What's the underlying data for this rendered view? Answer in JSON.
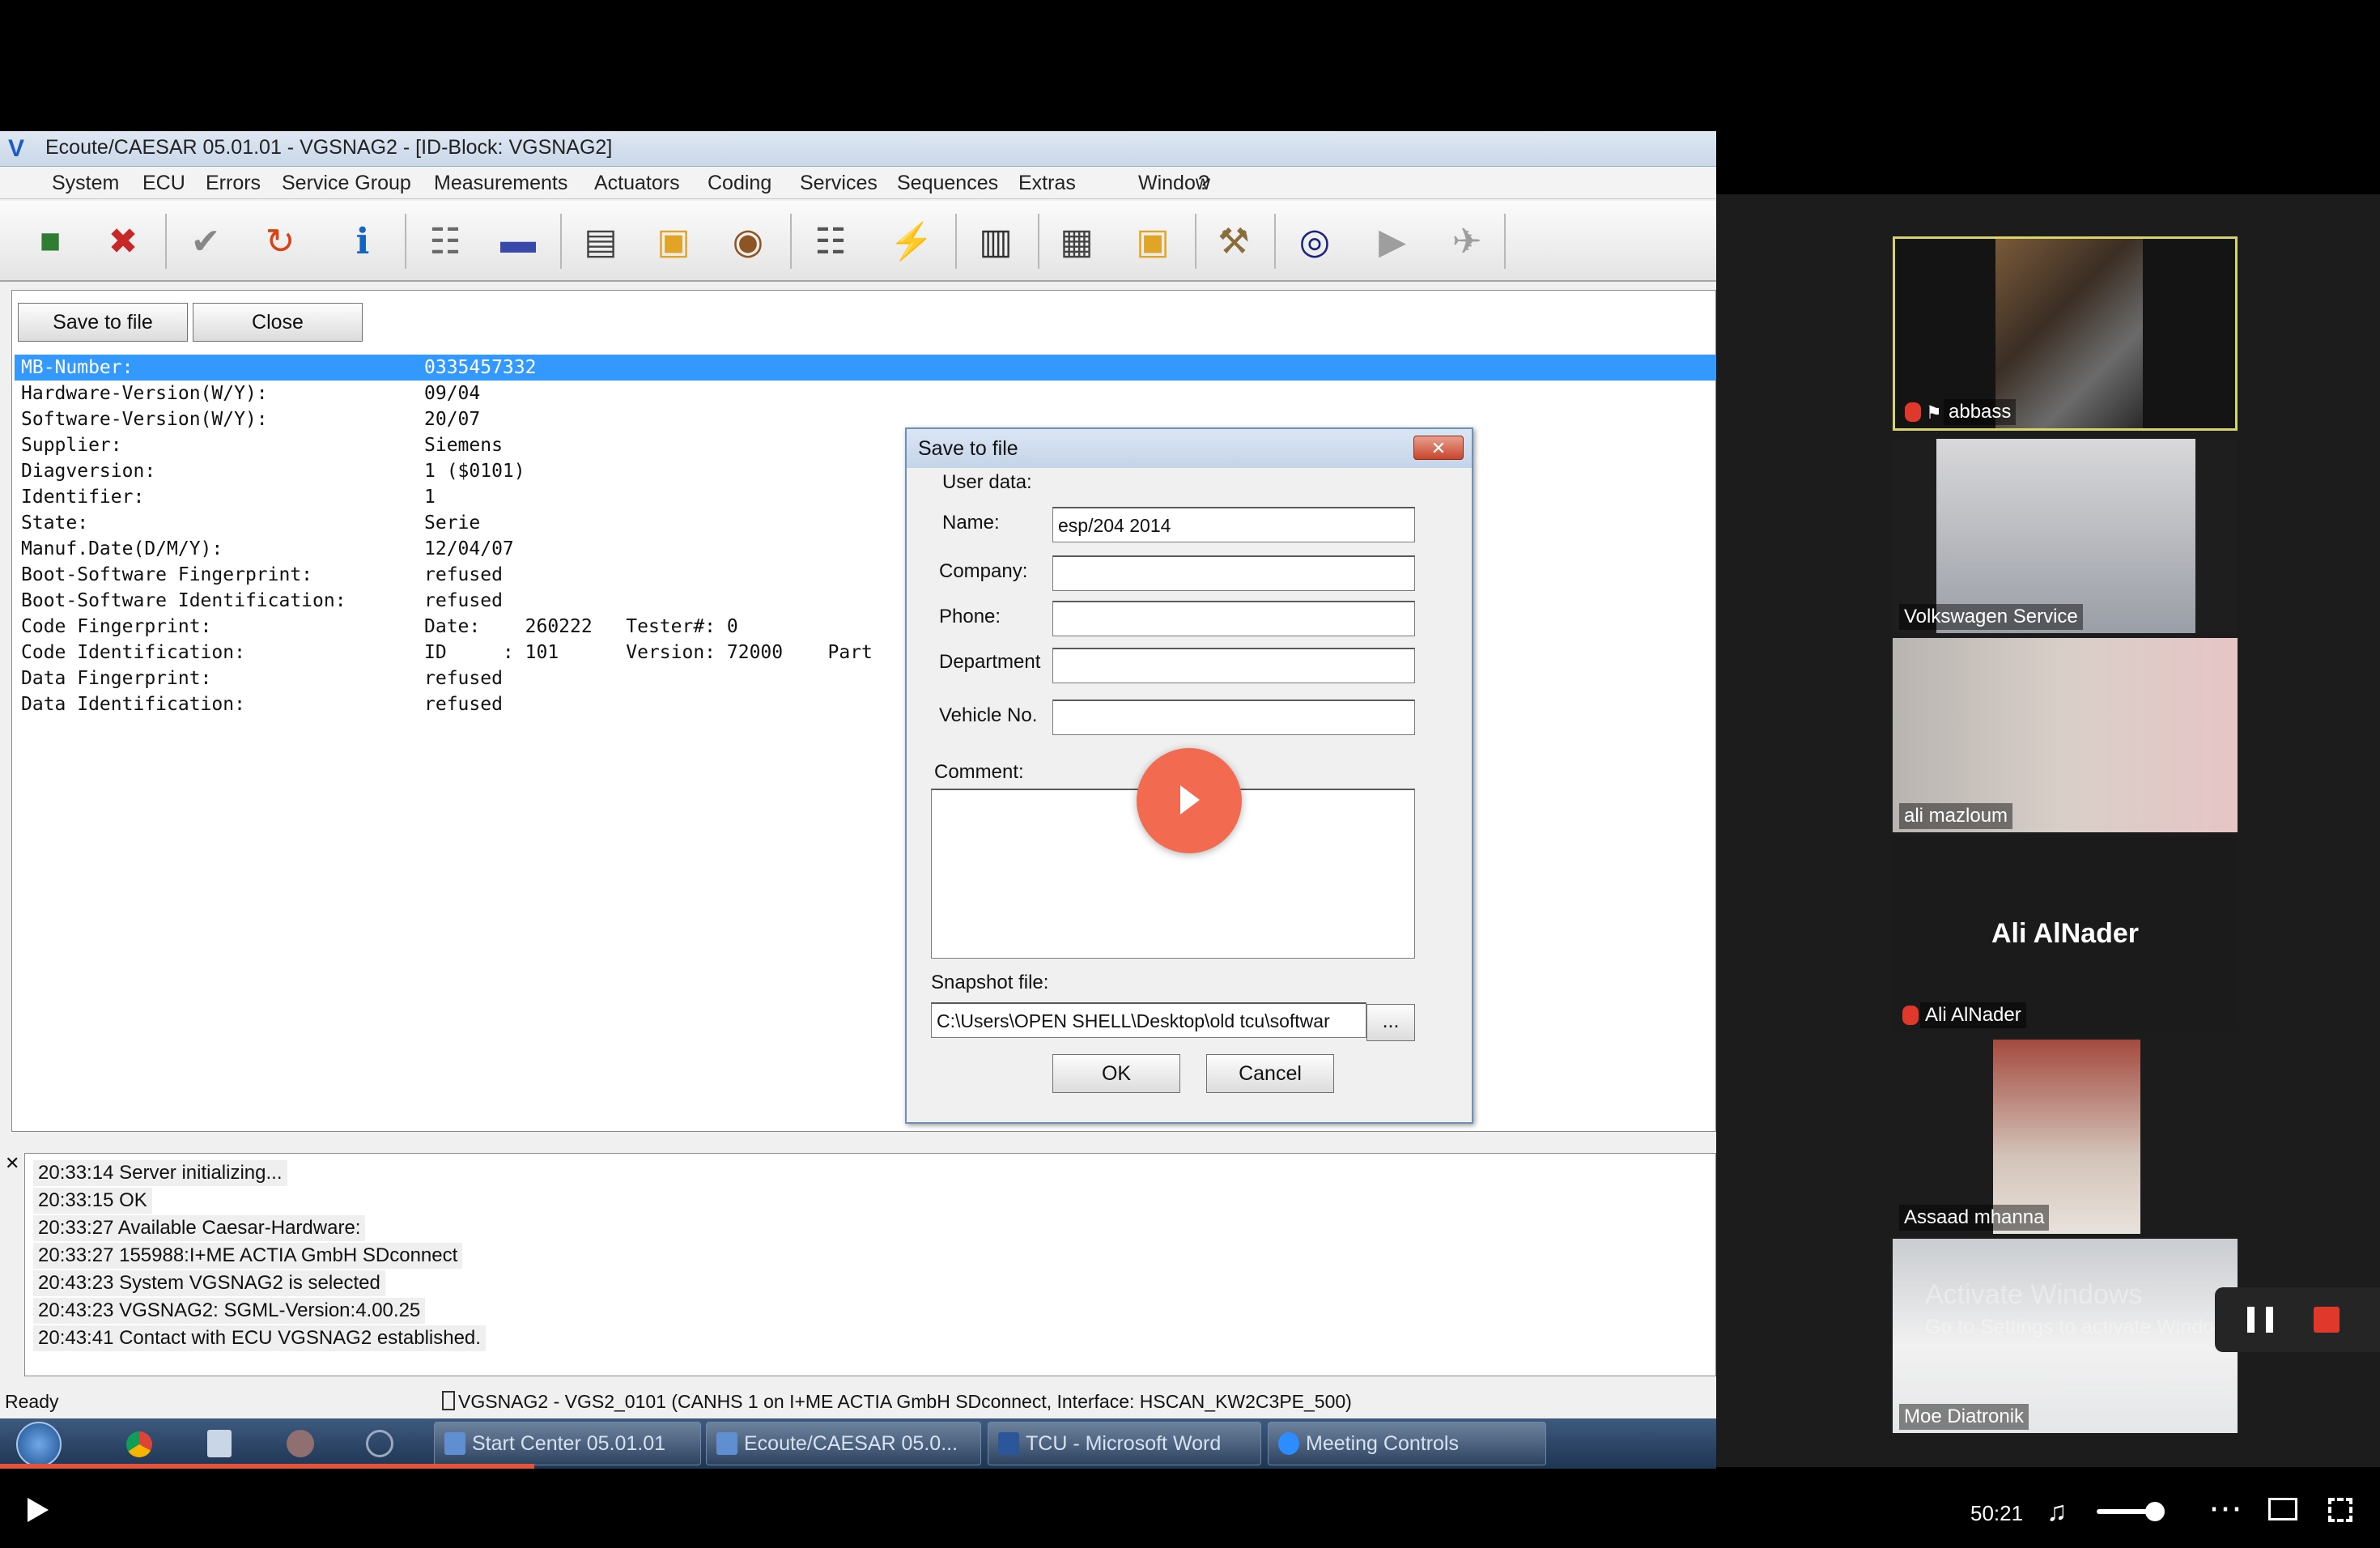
{
  "window": {
    "title": "Ecoute/CAESAR 05.01.01 - VGSNAG2 - [ID-Block: VGSNAG2]"
  },
  "menu": [
    "System",
    "ECU",
    "Errors",
    "Service Group",
    "Measurements",
    "Actuators",
    "Coding",
    "Services",
    "Sequences",
    "Extras",
    "Window",
    "?"
  ],
  "toolbar_icons": [
    "ecu-connect-icon",
    "ecu-disconnect-icon",
    "check-icon",
    "reset-icon",
    "hardware-info-icon",
    "fault-memory-icon",
    "vehicle-icon",
    "measure-window-icon",
    "open-folder-icon",
    "eye-icon",
    "network-tree-icon",
    "flash-icon",
    "document-icon",
    "table-list-icon",
    "save-folder-icon",
    "tools-icon",
    "binoculars-icon",
    "connector-icon",
    "plug-icon"
  ],
  "buttons": {
    "save_to_file": "Save to file",
    "close": "Close"
  },
  "id_block": [
    {
      "key": "MB-Number:",
      "value": "0335457332"
    },
    {
      "key": "Hardware-Version(W/Y):",
      "value": "09/04"
    },
    {
      "key": "Software-Version(W/Y):",
      "value": "20/07"
    },
    {
      "key": "Supplier:",
      "value": "Siemens"
    },
    {
      "key": "Diagversion:",
      "value": "1 ($0101)"
    },
    {
      "key": "Identifier:",
      "value": "1"
    },
    {
      "key": "State:",
      "value": "Serie"
    },
    {
      "key": "Manuf.Date(D/M/Y):",
      "value": "12/04/07"
    },
    {
      "key": "Boot-Software Fingerprint:",
      "value": "refused"
    },
    {
      "key": "Boot-Software Identification:",
      "value": "refused"
    },
    {
      "key": "Code Fingerprint:",
      "value": "Date:    260222   Tester#: 0"
    },
    {
      "key": "Code Identification:",
      "value": "ID     : 101      Version: 72000    Part"
    },
    {
      "key": "Data Fingerprint:",
      "value": "refused"
    },
    {
      "key": "Data Identification:",
      "value": "refused"
    }
  ],
  "dialog": {
    "title": "Save to file",
    "user_data": "User data:",
    "name_label": "Name:",
    "name_value": "esp/204 2014",
    "company_label": "Company:",
    "company_value": "",
    "phone_label": "Phone:",
    "phone_value": "",
    "department_label": "Department",
    "department_value": "",
    "vehicle_label": "Vehicle No.",
    "vehicle_value": "",
    "comment_label": "Comment:",
    "comment_value": "",
    "snapshot_label": "Snapshot file:",
    "snapshot_value": "C:\\Users\\OPEN SHELL\\Desktop\\old tcu\\softwar",
    "browse": "...",
    "ok": "OK",
    "cancel": "Cancel"
  },
  "log": [
    "20:33:14 Server initializing...",
    "20:33:15 OK",
    "20:33:27 Available Caesar-Hardware:",
    "20:33:27 155988:I+ME ACTIA GmbH SDconnect",
    "20:43:23 System VGSNAG2 is selected",
    "20:43:23 VGSNAG2: SGML-Version:4.00.25",
    "20:43:41 Contact with ECU VGSNAG2 established."
  ],
  "status": {
    "ready": "Ready",
    "connection": "VGSNAG2 - VGS2_0101 (CANHS 1 on I+ME ACTIA GmbH SDconnect, Interface: HSCAN_KW2C3PE_500)"
  },
  "taskbar": [
    "Start Center 05.01.01",
    "Ecoute/CAESAR 05.0...",
    "TCU - Microsoft Word",
    "Meeting Controls"
  ],
  "participants": [
    {
      "name": "abbass",
      "muted": true,
      "pinned": true,
      "active": true
    },
    {
      "name": "Volkswagen Service",
      "muted": false
    },
    {
      "name": "ali mazloum",
      "muted": false
    },
    {
      "name": "Ali AlNader",
      "muted": true,
      "video_off": true
    },
    {
      "name": "Assaad mhanna",
      "muted": false
    },
    {
      "name": "Moe Diatronik",
      "muted": false
    }
  ],
  "watermark": {
    "line1": "Activate Windows",
    "line2": "Go to Settings to activate Windows."
  },
  "video": {
    "time": "50:21",
    "volume": 0.8
  }
}
